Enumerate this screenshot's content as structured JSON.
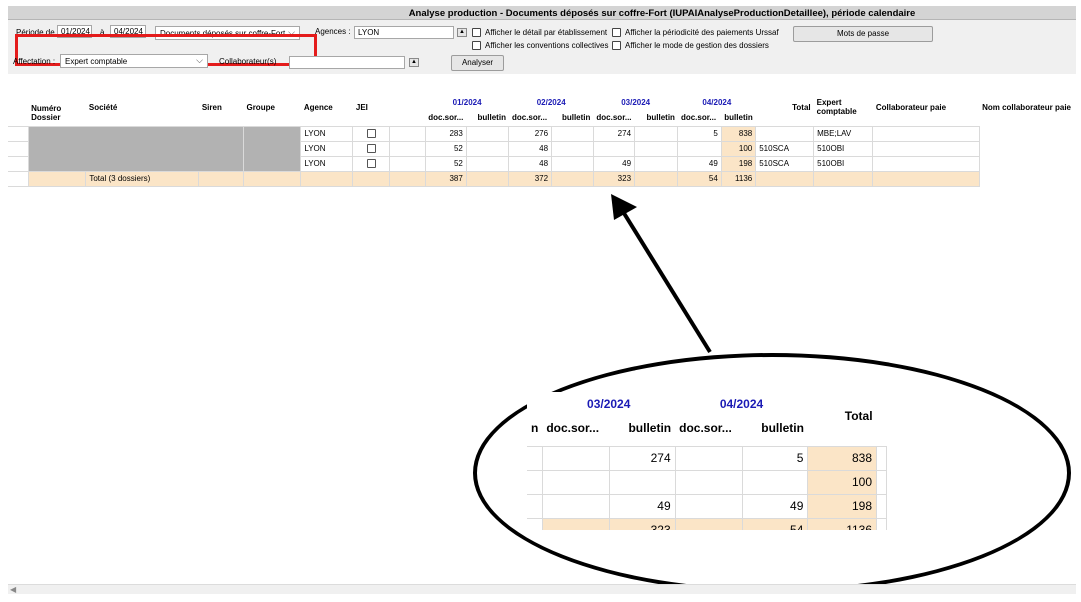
{
  "window": {
    "title": "Analyse production - Documents déposés sur coffre-Fort (IUPAIAnalyseProductionDetaillee), période calendaire"
  },
  "filters": {
    "periode_label": "Période de",
    "periode_from": "01/2024",
    "a_label": "à",
    "periode_to": "04/2024",
    "type_select": "Documents déposés sur coffre-Fort",
    "agences_label": "Agences :",
    "agences_value": "LYON",
    "affectation_label": "Affectation :",
    "affectation_value": "Expert comptable",
    "collaborateur_label": "Collaborateur(s)",
    "collaborateur_value": "",
    "checkboxes": [
      "Afficher le détail par établissement",
      "Afficher les conventions collectives",
      "Afficher la périodicité des paiements Urssaf",
      "Afficher le mode de gestion des dossiers"
    ],
    "analyser_label": "Analyser",
    "mots_de_passe_label": "Mots de passe"
  },
  "grid": {
    "headers": {
      "numero": "Numéro Dossier",
      "societe": "Société",
      "siren": "Siren",
      "groupe": "Groupe",
      "agence": "Agence",
      "jei": "JEI",
      "months": [
        "01/2024",
        "02/2024",
        "03/2024",
        "04/2024"
      ],
      "sub_doc": "doc.sor...",
      "sub_bulletin": "bulletin",
      "total": "Total",
      "expert": "Expert comptable",
      "collab": "Collaborateur paie",
      "nom_collab": "Nom collaborateur paie"
    },
    "rows": [
      {
        "agence": "LYON",
        "m1": "283",
        "m2": "276",
        "m3": "274",
        "m4": "5",
        "total": "838",
        "expert": "",
        "collab": "MBE;LAV"
      },
      {
        "agence": "LYON",
        "m1": "52",
        "m2": "48",
        "m3": "",
        "m4": "",
        "total": "100",
        "expert": "510SCA",
        "collab": "510OBI"
      },
      {
        "agence": "LYON",
        "m1": "52",
        "m2": "48",
        "m3": "49",
        "m4": "49",
        "total": "198",
        "expert": "510SCA",
        "collab": "510OBI"
      }
    ],
    "total_row": {
      "label": "Total (3 dossiers)",
      "m1": "387",
      "m2": "372",
      "m3": "323",
      "m4": "54",
      "total": "1136"
    }
  },
  "colors": {
    "highlight": "#e41b1b",
    "month_header": "#1b1bb5",
    "total_bg": "#fbe5c7"
  }
}
